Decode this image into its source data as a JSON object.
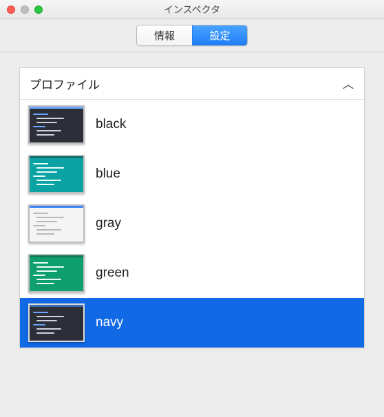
{
  "window": {
    "title": "インスペクタ"
  },
  "tabs": {
    "info_label": "情報",
    "settings_label": "設定",
    "active": "settings"
  },
  "section": {
    "header": "プロファイル"
  },
  "profiles": [
    {
      "label": "black",
      "theme": "black",
      "selected": false
    },
    {
      "label": "blue",
      "theme": "blue",
      "selected": false
    },
    {
      "label": "gray",
      "theme": "gray",
      "selected": false
    },
    {
      "label": "green",
      "theme": "green",
      "selected": false
    },
    {
      "label": "navy",
      "theme": "navy",
      "selected": true
    }
  ]
}
